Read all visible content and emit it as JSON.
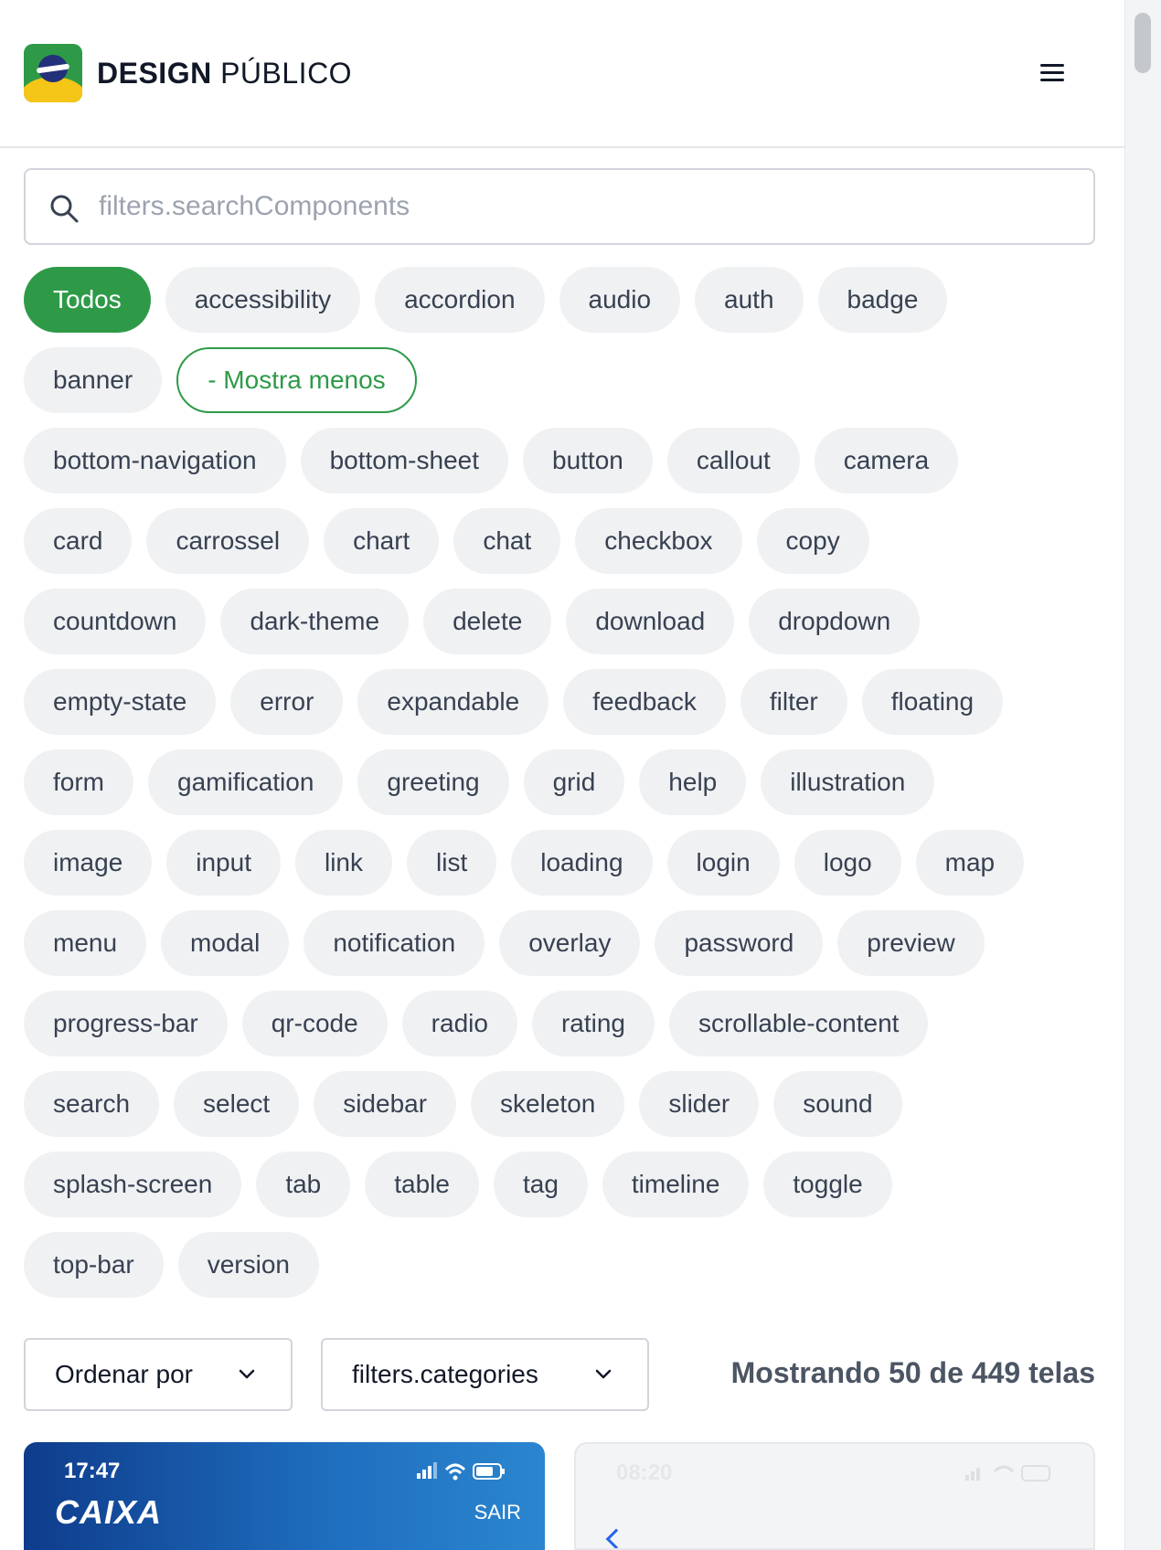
{
  "header": {
    "brand_bold": "DESIGN",
    "brand_light": "PÚBLICO"
  },
  "search": {
    "placeholder": "filters.searchComponents",
    "value": ""
  },
  "tags": {
    "row1": [
      "Todos",
      "accessibility",
      "accordion",
      "audio",
      "auth",
      "badge"
    ],
    "row2_chip": "banner",
    "toggle_label": "- Mostra menos",
    "rows": [
      [
        "bottom-navigation",
        "bottom-sheet",
        "button",
        "callout",
        "camera"
      ],
      [
        "card",
        "carrossel",
        "chart",
        "chat",
        "checkbox",
        "copy"
      ],
      [
        "countdown",
        "dark-theme",
        "delete",
        "download",
        "dropdown"
      ],
      [
        "empty-state",
        "error",
        "expandable",
        "feedback",
        "filter",
        "floating"
      ],
      [
        "form",
        "gamification",
        "greeting",
        "grid",
        "help",
        "illustration"
      ],
      [
        "image",
        "input",
        "link",
        "list",
        "loading",
        "login",
        "logo",
        "map"
      ],
      [
        "menu",
        "modal",
        "notification",
        "overlay",
        "password",
        "preview"
      ],
      [
        "progress-bar",
        "qr-code",
        "radio",
        "rating",
        "scrollable-content"
      ],
      [
        "search",
        "select",
        "sidebar",
        "skeleton",
        "slider",
        "sound"
      ],
      [
        "splash-screen",
        "tab",
        "table",
        "tag",
        "timeline",
        "toggle"
      ],
      [
        "top-bar",
        "version"
      ]
    ],
    "active": "Todos"
  },
  "filters": {
    "order_label": "Ordenar por",
    "categories_label": "filters.categories",
    "count_text": "Mostrando 50 de 449 telas"
  },
  "cards": [
    {
      "time": "17:47",
      "brand": "CAIXA",
      "action": "SAIR"
    },
    {
      "time": "08:20"
    }
  ],
  "colors": {
    "accent": "#2e9a48",
    "chip_bg": "#f0f1f3",
    "card_blue": "#1f6fbf"
  },
  "icons": {
    "menu": "hamburger-icon",
    "search": "search-icon",
    "chevron": "chevron-down-icon"
  }
}
